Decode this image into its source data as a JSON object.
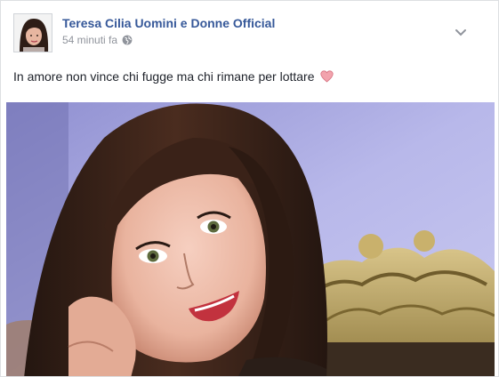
{
  "post": {
    "author_name": "Teresa Cilia Uomini e Donne Official",
    "timestamp": "54 minuti fa",
    "text": "In amore non vince chi fugge ma chi rimane per lottare",
    "emoji": "heart-icon",
    "privacy_icon": "globe-icon",
    "options_icon": "chevron-down-icon"
  },
  "colors": {
    "author_link": "#365899",
    "meta_text": "#90949c",
    "body_text": "#1d2129",
    "heart": "#f08a9a",
    "photo_background": "#b9b9e8"
  }
}
